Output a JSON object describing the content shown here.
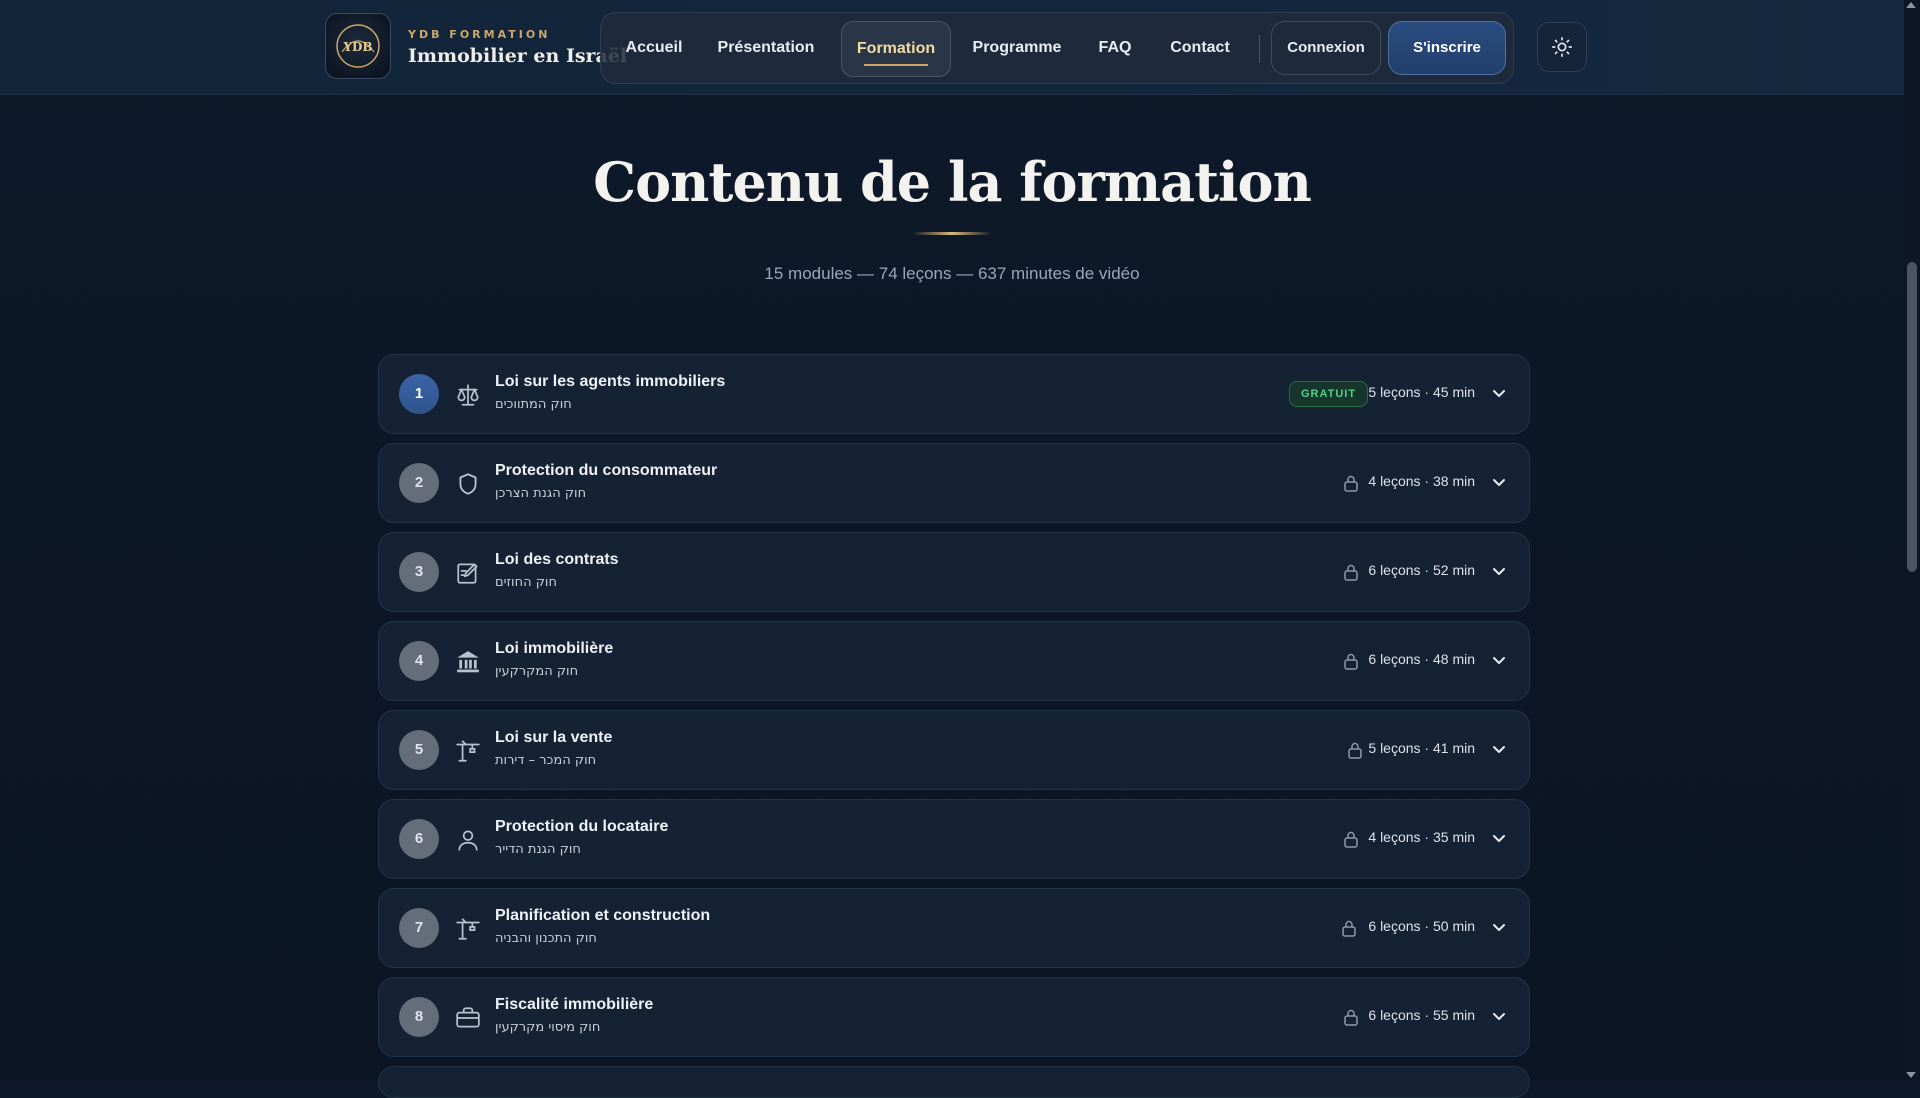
{
  "brand": {
    "small": "YDB FORMATION",
    "title": "Immobilier en Israël",
    "logo_text": "YDB"
  },
  "nav": {
    "items": [
      {
        "label": "Accueil",
        "active": false
      },
      {
        "label": "Présentation",
        "active": false
      },
      {
        "label": "Formation",
        "active": true
      },
      {
        "label": "Programme",
        "active": false
      },
      {
        "label": "FAQ",
        "active": false
      },
      {
        "label": "Contact",
        "active": false
      }
    ],
    "login_label": "Connexion",
    "signup_label": "S'inscrire",
    "theme_icon": "sun-icon"
  },
  "page": {
    "title": "Contenu de la formation",
    "subtitle": "15 modules — 74 leçons — 637 minutes de vidéo"
  },
  "modules": [
    {
      "number": "1",
      "title": "Loi sur les agents immobiliers",
      "subtitle": "חוק המתווכים",
      "meta": "5 leçons · 45 min",
      "badge": "GRATUIT",
      "icon": "scales-icon",
      "locked": false
    },
    {
      "number": "2",
      "title": "Protection du consommateur",
      "subtitle": "חוק הגנת הצרכן",
      "meta": "4 leçons · 38 min",
      "icon": "shield-icon",
      "locked": true
    },
    {
      "number": "3",
      "title": "Loi des contrats",
      "subtitle": "חוק החוזים",
      "meta": "6 leçons · 52 min",
      "icon": "edit-document-icon",
      "locked": true
    },
    {
      "number": "4",
      "title": "Loi immobilière",
      "subtitle": "חוק המקרקעין",
      "meta": "6 leçons · 48 min",
      "icon": "bank-building-icon",
      "locked": true
    },
    {
      "number": "5",
      "title": "Loi sur la vente",
      "subtitle": "חוק המכר – דירות",
      "meta": "5 leçons · 41 min",
      "icon": "crane-icon",
      "locked": true
    },
    {
      "number": "6",
      "title": "Protection du locataire",
      "subtitle": "חוק הגנת הדייר",
      "meta": "4 leçons · 35 min",
      "icon": "user-icon",
      "locked": true
    },
    {
      "number": "7",
      "title": "Planification et construction",
      "subtitle": "חוק התכנון והבניה",
      "meta": "6 leçons · 50 min",
      "icon": "crane-icon",
      "locked": true
    },
    {
      "number": "8",
      "title": "Fiscalité immobilière",
      "subtitle": "חוק מיסוי מקרקעין",
      "meta": "6 leçons · 55 min",
      "icon": "briefcase-icon",
      "locked": true
    }
  ],
  "colors": {
    "accent_gold": "#c9a86a",
    "primary_blue": "#2a4c80",
    "badge_green": "#4fd18b",
    "background": "#0c1727"
  }
}
